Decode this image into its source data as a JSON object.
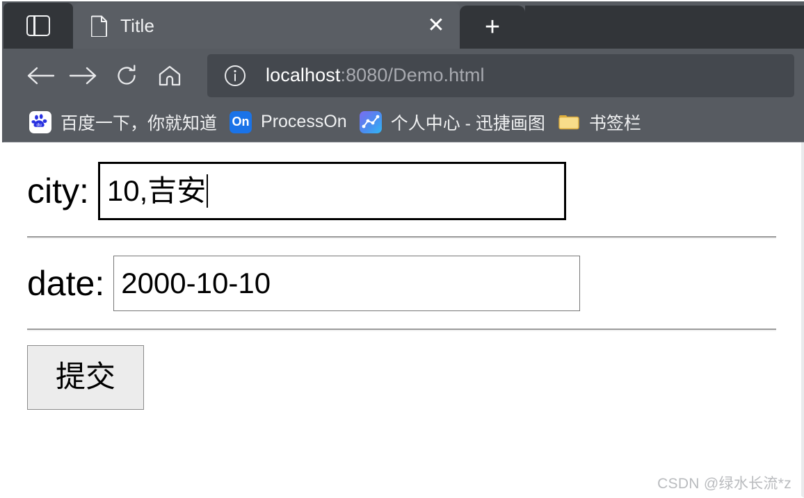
{
  "browser": {
    "tab_preview_icon": "panel-layout-icon",
    "tabs": [
      {
        "favicon": "document-icon",
        "title": "Title",
        "close_label": "✕"
      }
    ],
    "new_tab_label": "+",
    "toolbar": {
      "back_icon": "arrow-left-icon",
      "forward_icon": "arrow-right-icon",
      "reload_icon": "reload-icon",
      "home_icon": "home-icon",
      "omnibox": {
        "security_icon": "info-circle-icon",
        "host": "localhost",
        "path": ":8080/Demo.html",
        "full_url": "localhost:8080/Demo.html"
      }
    },
    "bookmarks": [
      {
        "icon": "baidu-icon",
        "label": "百度一下，你就知道"
      },
      {
        "icon": "processon-icon",
        "label": "ProcessOn",
        "icon_text": "On"
      },
      {
        "icon": "xunjie-chart-icon",
        "label": "个人中心 - 迅捷画图"
      },
      {
        "icon": "folder-icon",
        "label": "书签栏"
      }
    ]
  },
  "page": {
    "fields": [
      {
        "label": "city:",
        "value": "10,吉安",
        "placeholder": "",
        "focused": true
      },
      {
        "label": "date:",
        "value": "2000-10-10",
        "placeholder": "",
        "focused": false
      }
    ],
    "submit_label": "提交",
    "watermark": "CSDN @绿水长流*z"
  },
  "colors": {
    "chrome_bg": "#575b61",
    "tab_active_bg": "#5a5e64",
    "chrome_dark": "#323539",
    "omnibox_bg": "#44484e",
    "page_bg": "#ffffff",
    "accent_blue": "#1a73e8",
    "baidu_blue": "#2932e1",
    "folder_yellow": "#f7d674"
  }
}
